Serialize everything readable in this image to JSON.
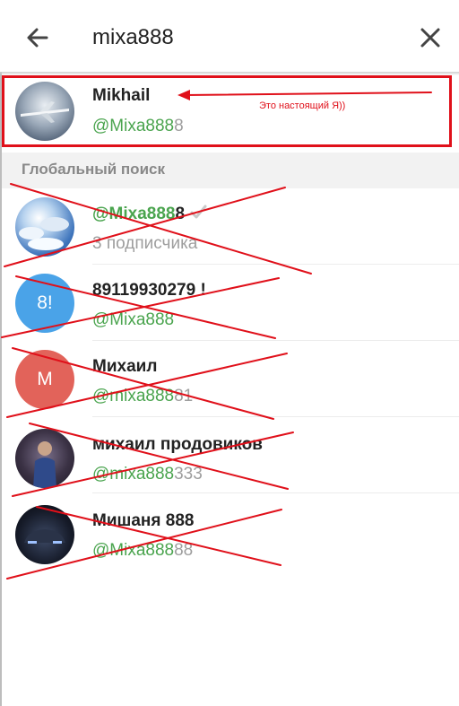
{
  "search": {
    "query": "mixa888"
  },
  "icons": {
    "back": "arrow-left-icon",
    "clear": "close-icon"
  },
  "top_result": {
    "name": "Mikhail",
    "username_match": "@Mixa888",
    "username_rest": "8"
  },
  "annotation": {
    "text": "Это настоящий Я))",
    "color": "#e0101a"
  },
  "section": {
    "title": "Глобальный поиск"
  },
  "results": [
    {
      "name_match": "@Mixa888",
      "name_rest": "8",
      "verified": true,
      "subtitle": "3 подписчика"
    },
    {
      "name": "89119930279 !",
      "username_match": "@Mixa888",
      "username_rest": "",
      "avatar_text": "8!",
      "avatar_color": "#4aa3e8"
    },
    {
      "name": "Михаил",
      "username_match": "@mixa888",
      "username_rest": "81",
      "avatar_text": "М",
      "avatar_color": "#e2635a"
    },
    {
      "name": "михаил продовиков",
      "username_match": "@mixa888",
      "username_rest": "333"
    },
    {
      "name": "Мишаня 888",
      "username_match": "@Mixa888",
      "username_rest": "88"
    }
  ],
  "colors": {
    "match_highlight": "#4aa44e",
    "cross_lines": "#e0101a"
  }
}
